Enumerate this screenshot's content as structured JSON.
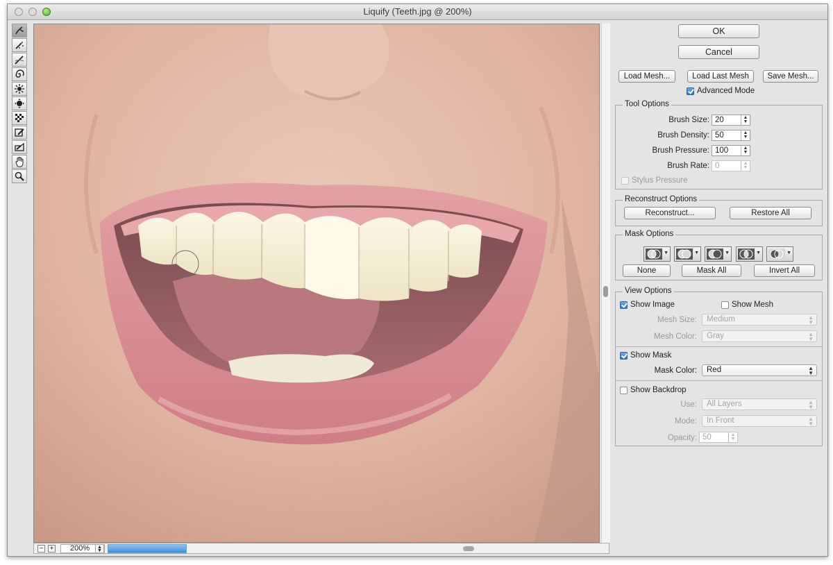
{
  "window": {
    "title": "Liquify (Teeth.jpg @ 200%)"
  },
  "tools": [
    {
      "name": "forward-warp-tool-icon",
      "active": true
    },
    {
      "name": "reconstruct-tool-icon"
    },
    {
      "name": "smooth-tool-icon"
    },
    {
      "name": "twirl-clockwise-tool-icon"
    },
    {
      "name": "pucker-tool-icon"
    },
    {
      "name": "bloat-tool-icon"
    },
    {
      "name": "push-left-tool-icon"
    },
    {
      "name": "freeze-mask-tool-icon"
    },
    {
      "name": "thaw-mask-tool-icon"
    },
    {
      "name": "hand-tool-icon"
    },
    {
      "name": "zoom-tool-icon"
    }
  ],
  "bottom_bar": {
    "zoom_value": "200%"
  },
  "buttons": {
    "ok": "OK",
    "cancel": "Cancel",
    "load_mesh": "Load Mesh...",
    "load_last_mesh": "Load Last Mesh",
    "save_mesh": "Save Mesh...",
    "advanced_mode": "Advanced Mode"
  },
  "tool_options": {
    "legend": "Tool Options",
    "brush_size_label": "Brush Size:",
    "brush_size": "20",
    "brush_density_label": "Brush Density:",
    "brush_density": "50",
    "brush_pressure_label": "Brush Pressure:",
    "brush_pressure": "100",
    "brush_rate_label": "Brush Rate:",
    "brush_rate": "0",
    "stylus_pressure": "Stylus Pressure"
  },
  "reconstruct_options": {
    "legend": "Reconstruct Options",
    "reconstruct": "Reconstruct...",
    "restore_all": "Restore All"
  },
  "mask_options": {
    "legend": "Mask Options",
    "none": "None",
    "mask_all": "Mask All",
    "invert_all": "Invert All"
  },
  "view_options": {
    "legend": "View Options",
    "show_image": "Show Image",
    "show_image_checked": true,
    "show_mesh": "Show Mesh",
    "show_mesh_checked": false,
    "mesh_size_label": "Mesh Size:",
    "mesh_size": "Medium",
    "mesh_color_label": "Mesh Color:",
    "mesh_color": "Gray",
    "show_mask": "Show Mask",
    "show_mask_checked": true,
    "mask_color_label": "Mask Color:",
    "mask_color": "Red",
    "show_backdrop": "Show Backdrop",
    "show_backdrop_checked": false,
    "use_label": "Use:",
    "use": "All Layers",
    "mode_label": "Mode:",
    "mode": "In Front",
    "opacity_label": "Opacity:",
    "opacity": "50"
  },
  "colors": {
    "accent": "#3c7fd0",
    "progress": "#4d9bdd",
    "skin": "#e3bba9",
    "lips": "#d9868e"
  }
}
